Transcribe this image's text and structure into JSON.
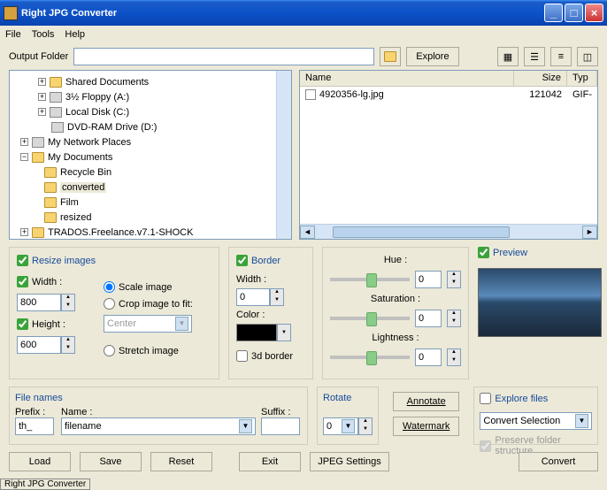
{
  "title": "Right JPG Converter",
  "menu": {
    "file": "File",
    "tools": "Tools",
    "help": "Help"
  },
  "toolbar": {
    "output_label": "Output Folder",
    "output_value": "",
    "explore": "Explore"
  },
  "tree": [
    {
      "indent": 30,
      "exp": "+",
      "icon": "fold",
      "label": "Shared Documents"
    },
    {
      "indent": 30,
      "exp": "+",
      "icon": "drv",
      "label": "3½ Floppy (A:)"
    },
    {
      "indent": 30,
      "exp": "+",
      "icon": "drv",
      "label": "Local Disk (C:)"
    },
    {
      "indent": 30,
      "exp": "",
      "icon": "drv",
      "label": "DVD-RAM Drive (D:)"
    },
    {
      "indent": 10,
      "exp": "+",
      "icon": "drv",
      "label": "My Network Places"
    },
    {
      "indent": 10,
      "exp": "−",
      "icon": "fold",
      "label": "My Documents"
    },
    {
      "indent": 22,
      "exp": "",
      "icon": "fold",
      "label": "Recycle Bin"
    },
    {
      "indent": 22,
      "exp": "",
      "icon": "fold",
      "label": "converted",
      "sel": true
    },
    {
      "indent": 22,
      "exp": "",
      "icon": "fold",
      "label": "Film"
    },
    {
      "indent": 22,
      "exp": "",
      "icon": "fold",
      "label": "resized"
    },
    {
      "indent": 10,
      "exp": "+",
      "icon": "fold",
      "label": "TRADOS.Freelance.v7.1-SHOCK"
    }
  ],
  "filecols": {
    "name": "Name",
    "size": "Size",
    "type": "Typ"
  },
  "filerow": {
    "name": "4920356-lg.jpg",
    "size": "121042",
    "type": "GIF-"
  },
  "resize": {
    "title": "Resize images",
    "width": "Width :",
    "width_v": "800",
    "height": "Height :",
    "height_v": "600",
    "scale": "Scale image",
    "crop": "Crop image to fit:",
    "crop_sel": "Center",
    "stretch": "Stretch image"
  },
  "border": {
    "title": "Border",
    "width": "Width :",
    "width_v": "0",
    "color": "Color :",
    "threed": "3d border"
  },
  "hsl": {
    "hue": "Hue :",
    "hue_v": "0",
    "sat": "Saturation :",
    "sat_v": "0",
    "light": "Lightness :",
    "light_v": "0"
  },
  "preview": {
    "title": "Preview"
  },
  "fnames": {
    "title": "File names",
    "prefix": "Prefix :",
    "prefix_v": "th_",
    "name": "Name :",
    "name_v": "filename",
    "suffix": "Suffix :",
    "suffix_v": ""
  },
  "rotate": {
    "title": "Rotate",
    "val": "0"
  },
  "annotate": "Annotate",
  "watermark": "Watermark",
  "explore": {
    "title": "Explore files",
    "sel": "Convert Selection",
    "preserve": "Preserve folder structure"
  },
  "buttons": {
    "load": "Load",
    "save": "Save",
    "reset": "Reset",
    "exit": "Exit",
    "jpeg": "JPEG Settings",
    "convert": "Convert"
  },
  "taskbar": "Right JPG Converter"
}
